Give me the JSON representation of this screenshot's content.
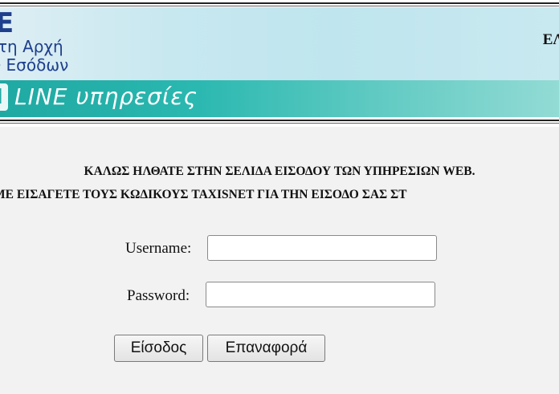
{
  "header": {
    "logo_mark": "E",
    "logo_line1": "τη Αρχή",
    "logo_line2": "ν Εσόδων",
    "top_right_text": "ΕΛ",
    "banner_mark": "N",
    "banner_text": "LINE υπηρεσίες"
  },
  "main": {
    "welcome_text": "ΚΑΛΩΣ ΗΛΘΑΤΕ ΣΤΗΝ ΣΕΛΙΔΑ ΕΙΣΟΔΟΥ ΤΩΝ ΥΠΗΡΕΣΙΩΝ WEB.",
    "instructions_text": "ΜΕ ΕΙΣΑΓΕΤΕ ΤΟΥΣ ΚΩΔΙΚΟΥΣ TAXISNET ΓΙΑ ΤΗΝ ΕΙΣΟΔΟ ΣΑΣ ΣΤ"
  },
  "form": {
    "username_label": "Username:",
    "username_value": "",
    "password_label": "Password:",
    "password_value": "",
    "login_button": "Είσοδος",
    "reset_button": "Επαναφορά"
  },
  "colors": {
    "brand_blue": "#1e3f8c",
    "banner_teal": "#1fa9a3",
    "page_background": "#f2f2f2"
  }
}
